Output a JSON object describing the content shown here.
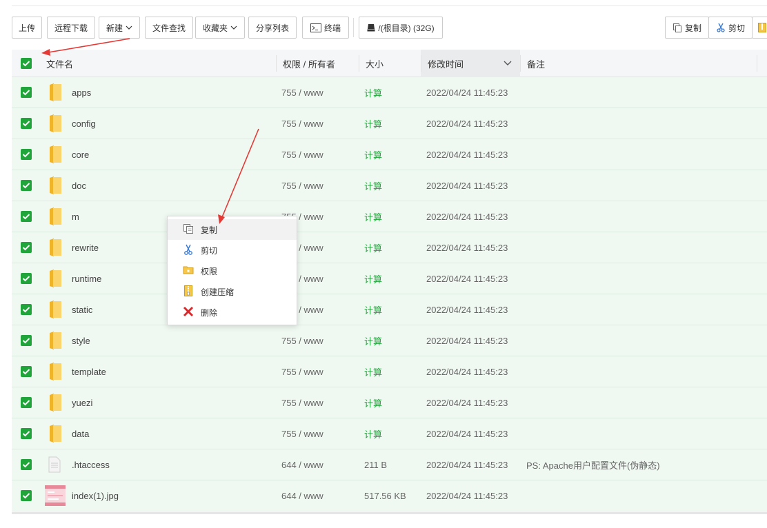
{
  "toolbar": {
    "upload": "上传",
    "remote_download": "远程下载",
    "new": "新建",
    "file_search": "文件查找",
    "favorites": "收藏夹",
    "share_list": "分享列表",
    "terminal": "终端",
    "disk": "/(根目录) (32G)",
    "copy": "复制",
    "cut": "剪切"
  },
  "table": {
    "headers": {
      "name": "文件名",
      "perm": "权限 / 所有者",
      "size": "大小",
      "mtime": "修改时间",
      "note": "备注"
    },
    "rows": [
      {
        "name": "apps",
        "perm": "755 / www",
        "size": "计算",
        "mtime": "2022/04/24 11:45:23",
        "note": "",
        "type": "folder"
      },
      {
        "name": "config",
        "perm": "755 / www",
        "size": "计算",
        "mtime": "2022/04/24 11:45:23",
        "note": "",
        "type": "folder"
      },
      {
        "name": "core",
        "perm": "755 / www",
        "size": "计算",
        "mtime": "2022/04/24 11:45:23",
        "note": "",
        "type": "folder"
      },
      {
        "name": "doc",
        "perm": "755 / www",
        "size": "计算",
        "mtime": "2022/04/24 11:45:23",
        "note": "",
        "type": "folder"
      },
      {
        "name": "m",
        "perm": "755 / www",
        "size": "计算",
        "mtime": "2022/04/24 11:45:23",
        "note": "",
        "type": "folder"
      },
      {
        "name": "rewrite",
        "perm": "755 / www",
        "size": "计算",
        "mtime": "2022/04/24 11:45:23",
        "note": "",
        "type": "folder"
      },
      {
        "name": "runtime",
        "perm": "755 / www",
        "size": "计算",
        "mtime": "2022/04/24 11:45:23",
        "note": "",
        "type": "folder"
      },
      {
        "name": "static",
        "perm": "755 / www",
        "size": "计算",
        "mtime": "2022/04/24 11:45:23",
        "note": "",
        "type": "folder"
      },
      {
        "name": "style",
        "perm": "755 / www",
        "size": "计算",
        "mtime": "2022/04/24 11:45:23",
        "note": "",
        "type": "folder"
      },
      {
        "name": "template",
        "perm": "755 / www",
        "size": "计算",
        "mtime": "2022/04/24 11:45:23",
        "note": "",
        "type": "folder"
      },
      {
        "name": "yuezi",
        "perm": "755 / www",
        "size": "计算",
        "mtime": "2022/04/24 11:45:23",
        "note": "",
        "type": "folder"
      },
      {
        "name": "data",
        "perm": "755 / www",
        "size": "计算",
        "mtime": "2022/04/24 11:45:23",
        "note": "",
        "type": "folder"
      },
      {
        "name": ".htaccess",
        "perm": "644 / www",
        "size": "211 B",
        "mtime": "2022/04/24 11:45:23",
        "note": "PS: Apache用户配置文件(伪静态)",
        "type": "file"
      },
      {
        "name": "index(1).jpg",
        "perm": "644 / www",
        "size": "517.56 KB",
        "mtime": "2022/04/24 11:45:23",
        "note": "",
        "type": "image"
      }
    ]
  },
  "context_menu": [
    {
      "label": "复制",
      "icon": "copy-icon"
    },
    {
      "label": "剪切",
      "icon": "scissors-icon"
    },
    {
      "label": "权限",
      "icon": "folder-lock-icon"
    },
    {
      "label": "创建压缩",
      "icon": "zip-icon"
    },
    {
      "label": "删除",
      "icon": "delete-icon"
    }
  ],
  "colors": {
    "accent_green": "#20a53a",
    "row_selected": "#f0f8f2",
    "annotation_red": "#e53935"
  }
}
